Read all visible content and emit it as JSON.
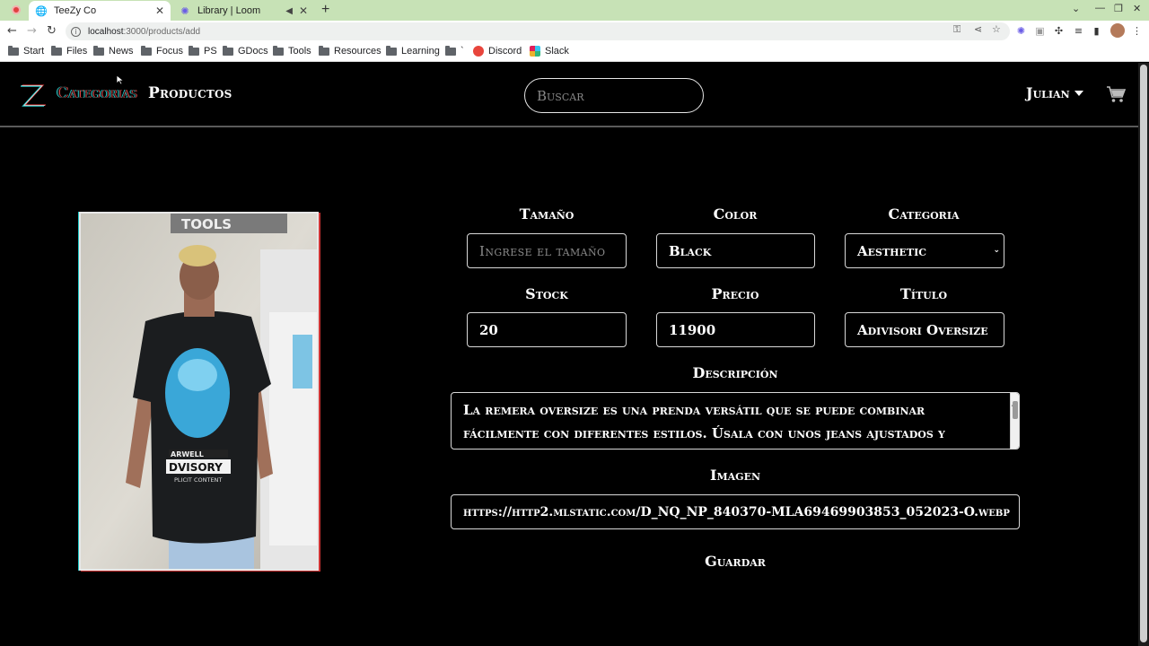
{
  "browser": {
    "tabs": [
      {
        "title": "TeeZy Co",
        "active": true
      },
      {
        "title": "Library | Loom",
        "active": false
      }
    ],
    "url_host": "localhost",
    "url_path": ":3000/products/add",
    "bookmarks": [
      "Start",
      "Files",
      "News",
      "Focus",
      "PS",
      "GDocs",
      "Tools",
      "Resources",
      "Learning",
      "`",
      "Discord",
      "Slack"
    ]
  },
  "navbar": {
    "categories_label": "Categorias",
    "products_label": "Productos",
    "search_placeholder": "Buscar",
    "user_label": "Julian",
    "icons": [
      "logo-z-icon",
      "cart-icon",
      "caret-down-icon"
    ]
  },
  "form": {
    "size": {
      "label": "Tamaño",
      "placeholder": "Ingrese el tamaño",
      "value": ""
    },
    "color": {
      "label": "Color",
      "value": "Black"
    },
    "category": {
      "label": "Categoria",
      "value": "Aesthetic"
    },
    "stock": {
      "label": "Stock",
      "value": "20"
    },
    "price": {
      "label": "Precio",
      "value": "11900"
    },
    "title": {
      "label": "Título",
      "value": "Adivisori Oversize"
    },
    "description": {
      "label": "Descripción",
      "value": "La remera oversize es una prenda versátil que se puede combinar fácilmente con diferentes estilos. Úsala con unos jeans ajustados y zapatillas para un"
    },
    "image": {
      "label": "Imagen",
      "value": "https://http2.mlstatic.com/D_NQ_NP_840370-MLA69469903853_052023-O.webp"
    },
    "save_label": "Guardar"
  },
  "product_image": {
    "shirt_print_lines": [
      "ARWELL",
      "DVISORY",
      "PLICIT CONTENT"
    ],
    "sign_text": "TOOLS"
  },
  "colors": {
    "background": "#000000",
    "text": "#ffffff",
    "border": "#d8d8d8",
    "tabbar": "#c7e2b6"
  }
}
